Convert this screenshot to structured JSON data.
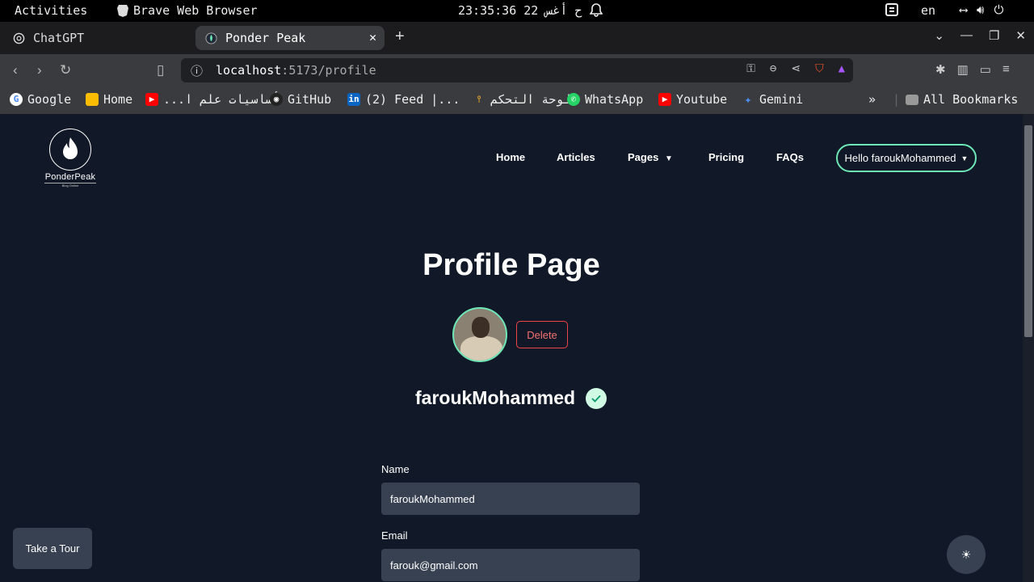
{
  "system": {
    "activities": "Activities",
    "app_name": "Brave Web Browser",
    "clock": "23:35:36 22 ح أغس",
    "language": "en"
  },
  "tabs": [
    {
      "title": "ChatGPT",
      "icon": "chatgpt-icon"
    },
    {
      "title": "Ponder Peak",
      "icon": "ponderpeak-icon",
      "active": true
    }
  ],
  "address": {
    "host": "localhost",
    "path": ":5173/profile"
  },
  "bookmarks": [
    {
      "label": "Google",
      "icon": "google-icon"
    },
    {
      "label": "Home",
      "icon": "classroom-icon"
    },
    {
      "label": "أساسيات علم ا...",
      "icon": "youtube-icon"
    },
    {
      "label": "GitHub",
      "icon": "github-icon"
    },
    {
      "label": "(2) Feed |...",
      "icon": "linkedin-icon"
    },
    {
      "label": "لوحة التحكم",
      "icon": "dashboard-icon"
    },
    {
      "label": "WhatsApp",
      "icon": "whatsapp-icon"
    },
    {
      "label": "Youtube",
      "icon": "youtube-icon"
    },
    {
      "label": "Gemini",
      "icon": "gemini-icon"
    },
    {
      "label": "All Bookmarks",
      "icon": "folder-icon"
    }
  ],
  "site": {
    "logo_name": "PonderPeak",
    "logo_tag": "Blog Online",
    "nav": [
      "Home",
      "Articles",
      "Pages",
      "Pricing",
      "FAQs"
    ],
    "user_menu": "Hello faroukMohammed"
  },
  "profile": {
    "title": "Profile Page",
    "delete_label": "Delete",
    "username": "faroukMohammed",
    "name_label": "Name",
    "name_value": "faroukMohammed",
    "email_label": "Email",
    "email_value": "farouk@gmail.com"
  },
  "tour_label": "Take a Tour",
  "colors": {
    "background": "#111827",
    "accent": "#6ee7b7",
    "danger": "#ef4444",
    "field": "#374151"
  }
}
